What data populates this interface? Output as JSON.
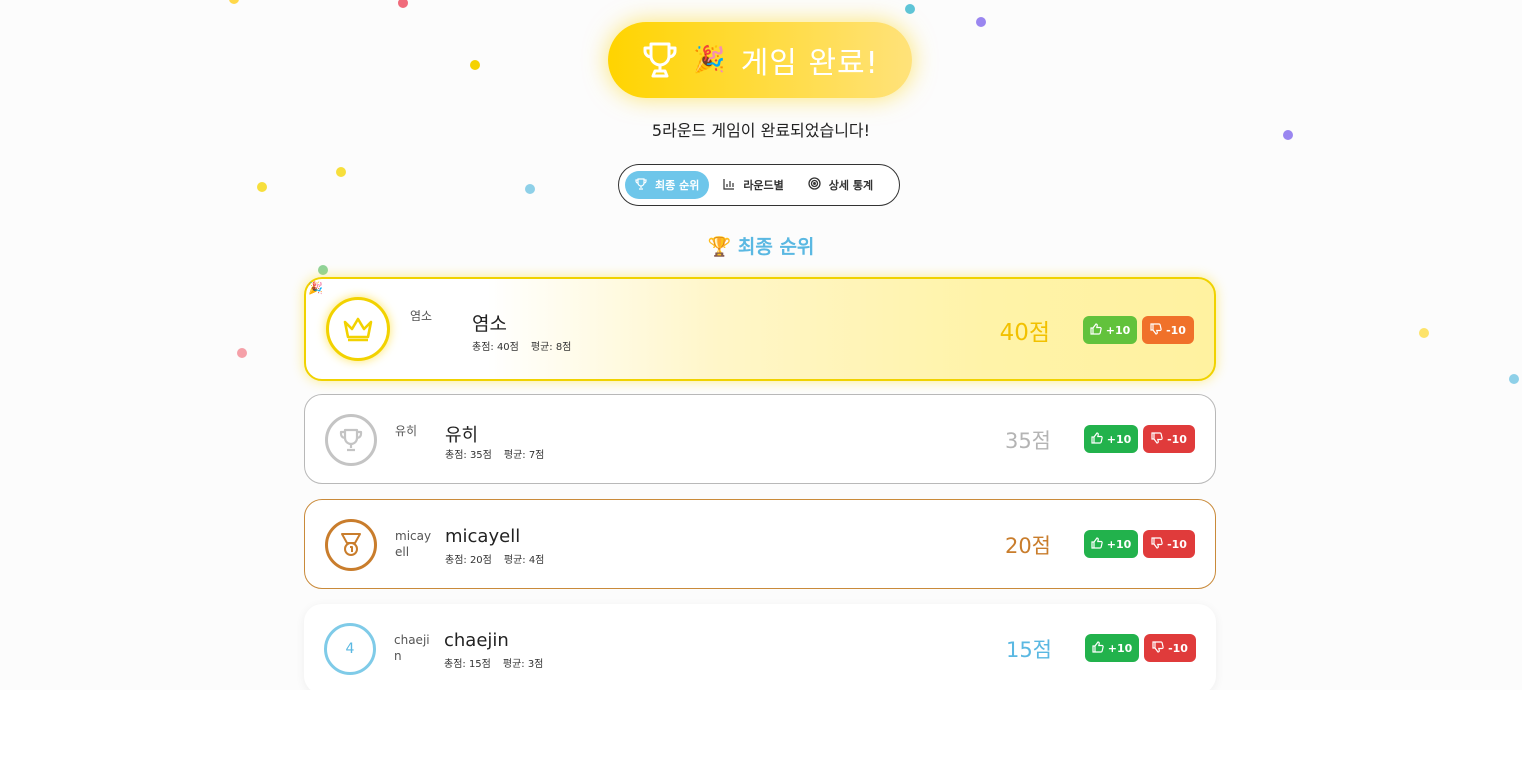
{
  "hero": {
    "title": "게임 완료!",
    "party_icon": "🎉"
  },
  "subtitle": "5라운드 게임이 완료되었습니다!",
  "tabs": [
    {
      "label": "최종 순위",
      "icon": "trophy-icon",
      "active": true
    },
    {
      "label": "라운드별",
      "icon": "bar-chart-icon",
      "active": false
    },
    {
      "label": "상세 통계",
      "icon": "target-icon",
      "active": false
    }
  ],
  "section": {
    "title": "최종 순위",
    "icon": "🏆"
  },
  "players": [
    {
      "rank": "1",
      "badge_icon": "crown-icon",
      "avatar_alt": "염소",
      "name": "염소",
      "total": "총점: 40점",
      "avg": "평균: 8점",
      "score": "40점",
      "up_label": "+10",
      "down_label": "-10",
      "corner": "🎉"
    },
    {
      "rank": "2",
      "badge_icon": "trophy-icon",
      "avatar_alt": "유히",
      "name": "유히",
      "total": "총점: 35점",
      "avg": "평균: 7점",
      "score": "35점",
      "up_label": "+10",
      "down_label": "-10"
    },
    {
      "rank": "3",
      "badge_icon": "medal-icon",
      "avatar_alt": "micayell",
      "name": "micayell",
      "total": "총점: 20점",
      "avg": "평균: 4점",
      "score": "20점",
      "up_label": "+10",
      "down_label": "-10"
    },
    {
      "rank": "4",
      "badge_icon": "rank-number",
      "avatar_alt": "chaejin",
      "name": "chaejin",
      "total": "총점: 15점",
      "avg": "평균: 3점",
      "score": "15점",
      "up_label": "+10",
      "down_label": "-10"
    }
  ],
  "colors": {
    "gold": "#f2d200",
    "silver": "#c4c4c4",
    "bronze": "#c97d2c",
    "accent": "#6ec6ea",
    "up": "#22b24c",
    "down": "#e03b3b"
  }
}
